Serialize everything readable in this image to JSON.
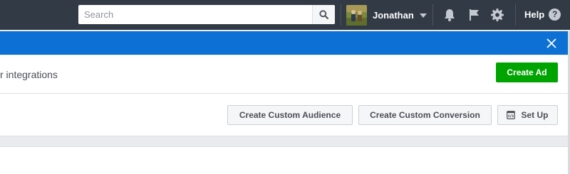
{
  "topbar": {
    "search_placeholder": "Search",
    "user_name": "Jonathan",
    "help_label": "Help",
    "help_symbol": "?"
  },
  "header": {
    "partial_title": "r integrations",
    "create_ad_label": "Create Ad"
  },
  "toolbar": {
    "create_custom_audience_label": "Create Custom Audience",
    "create_custom_conversion_label": "Create Custom Conversion",
    "set_up_label": "Set Up"
  },
  "colors": {
    "topbar": "#323a45",
    "notice_bar": "#0c70d4",
    "create_ad_green": "#00a400",
    "page_background": "#e9ebee"
  },
  "icons": [
    "search-icon",
    "notifications-bell-icon",
    "flag-icon",
    "settings-gear-icon",
    "help-icon",
    "close-icon",
    "code-setup-icon"
  ]
}
